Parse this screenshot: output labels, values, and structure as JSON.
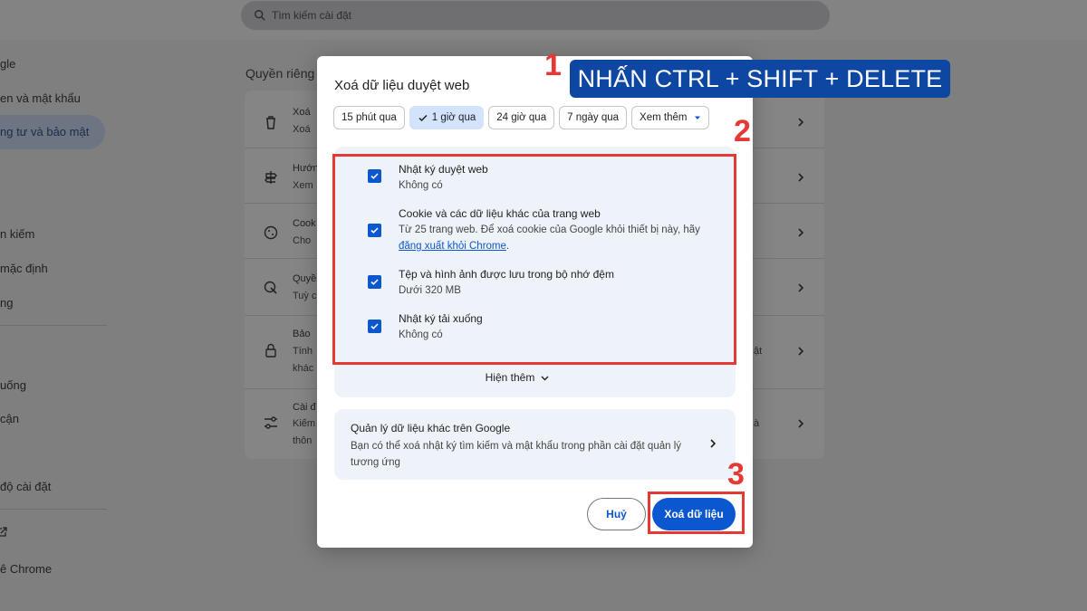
{
  "search": {
    "placeholder": "Tìm kiếm cài đặt"
  },
  "sidebar": {
    "items": [
      "gle",
      "en và mật khẩu",
      "ng tư và bảo mật",
      "n kiếm",
      "mặc định",
      "ng",
      "uống",
      "cận",
      "độ cài đặt",
      "ê Chrome"
    ]
  },
  "background": {
    "heading": "Quyền riêng",
    "rows": [
      {
        "t1": "Xoá",
        "t2": "Xoá"
      },
      {
        "t1": "Hướn",
        "t2": "Xem"
      },
      {
        "t1": "Cook",
        "t2": "Cho"
      },
      {
        "t1": "Quyề",
        "t2": "Tuỳ c"
      },
      {
        "t1": "Bảo",
        "t2": "Tính",
        "t3": "khác"
      },
      {
        "t1": "Cài đ",
        "t2": "Kiếm",
        "t3": "thôn"
      }
    ],
    "extra_right_1": "ật",
    "extra_right_2": "à"
  },
  "dialog": {
    "title": "Xoá dữ liệu duyệt web",
    "chips": [
      "15 phút qua",
      "1 giờ qua",
      "24 giờ qua",
      "7 ngày qua",
      "Xem thêm"
    ],
    "selected_chip": "1 giờ qua",
    "options": [
      {
        "title": "Nhật ký duyệt web",
        "desc": "Không có",
        "checked": true
      },
      {
        "title": "Cookie và các dữ liệu khác của trang web",
        "desc": "Từ 25 trang web. Để xoá cookie của Google khỏi thiết bị này, hãy",
        "link": "đăng xuất khỏi Chrome",
        "link_suffix": ".",
        "checked": true
      },
      {
        "title": "Tệp và hình ảnh được lưu trong bộ nhớ đệm",
        "desc": "Dưới 320 MB",
        "checked": true
      },
      {
        "title": "Nhật ký tải xuống",
        "desc": "Không có",
        "checked": true
      }
    ],
    "show_more": "Hiện thêm",
    "manage": {
      "title": "Quản lý dữ liệu khác trên Google",
      "desc": "Bạn có thể xoá nhật ký tìm kiếm và mật khẩu trong phần cài đặt quản lý tương ứng"
    },
    "cancel_label": "Huỷ",
    "delete_label": "Xoá dữ liệu"
  },
  "annotations": {
    "banner": "NHẤN CTRL + SHIFT + DELETE",
    "step1": "1",
    "step2": "2",
    "step3": "3",
    "color": "#e53935",
    "banner_color": "#0d47a1"
  },
  "colors": {
    "accent": "#0b57d0",
    "chip_selected": "#d3e3fd",
    "panel": "#eef2f9"
  }
}
